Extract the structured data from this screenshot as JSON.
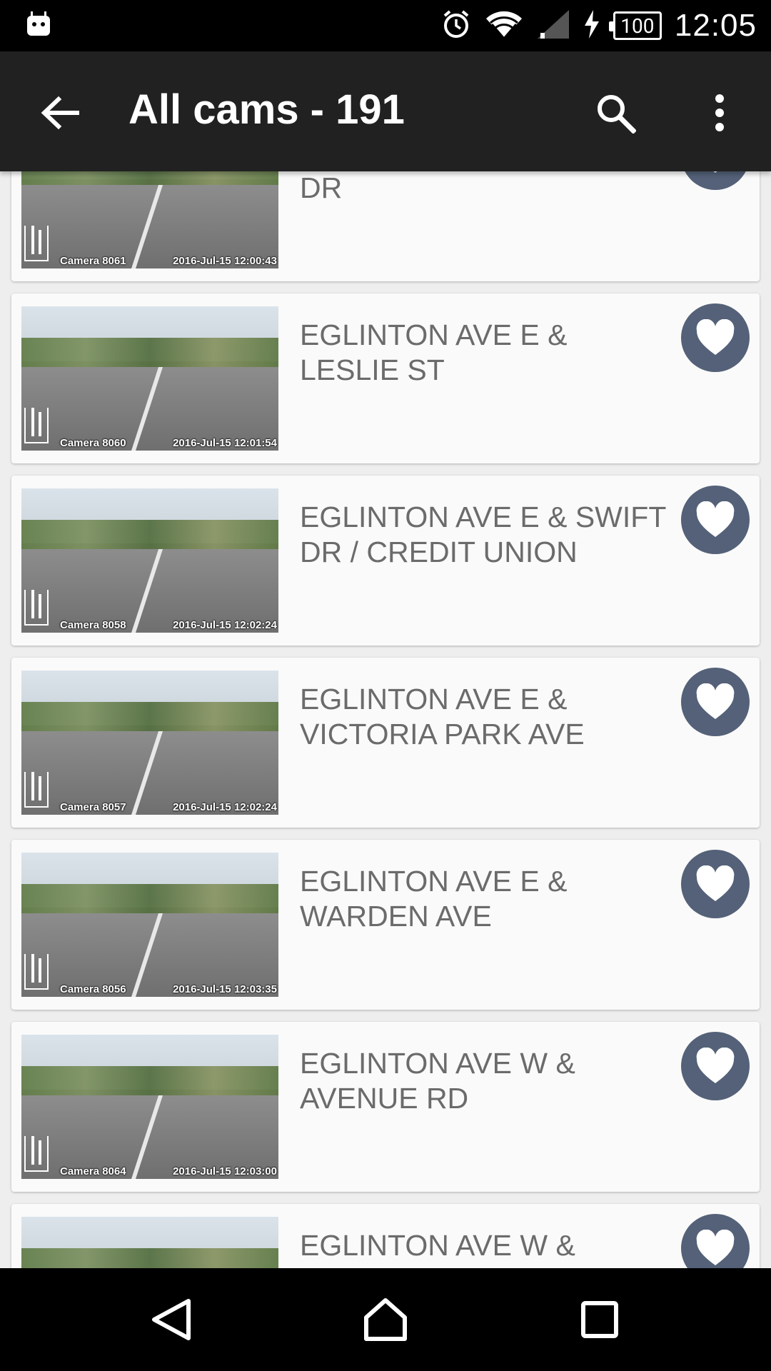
{
  "status_bar": {
    "battery": "100",
    "time": "12:05"
  },
  "app_bar": {
    "title": "All cams - 191"
  },
  "cameras": [
    {
      "title": "EGLINTON AVE E & LAIRD DR",
      "camera": "Camera 8061",
      "timestamp": "2016-Jul-15 12:00:43"
    },
    {
      "title": "EGLINTON AVE E & LESLIE ST",
      "camera": "Camera 8060",
      "timestamp": "2016-Jul-15 12:01:54"
    },
    {
      "title": "EGLINTON AVE E & SWIFT DR / CREDIT UNION",
      "camera": "Camera 8058",
      "timestamp": "2016-Jul-15 12:02:24"
    },
    {
      "title": "EGLINTON AVE E & VICTORIA PARK AVE",
      "camera": "Camera 8057",
      "timestamp": "2016-Jul-15 12:02:24"
    },
    {
      "title": "EGLINTON AVE E & WARDEN AVE",
      "camera": "Camera 8056",
      "timestamp": "2016-Jul-15 12:03:35"
    },
    {
      "title": "EGLINTON AVE W & AVENUE RD",
      "camera": "Camera 8064",
      "timestamp": "2016-Jul-15 12:03:00"
    },
    {
      "title": "EGLINTON AVE W &",
      "camera": "",
      "timestamp": ""
    }
  ],
  "colors": {
    "app_bar": "#212121",
    "fav_button": "#546178",
    "card": "#fafafa",
    "title_text": "#6b6b6b"
  }
}
